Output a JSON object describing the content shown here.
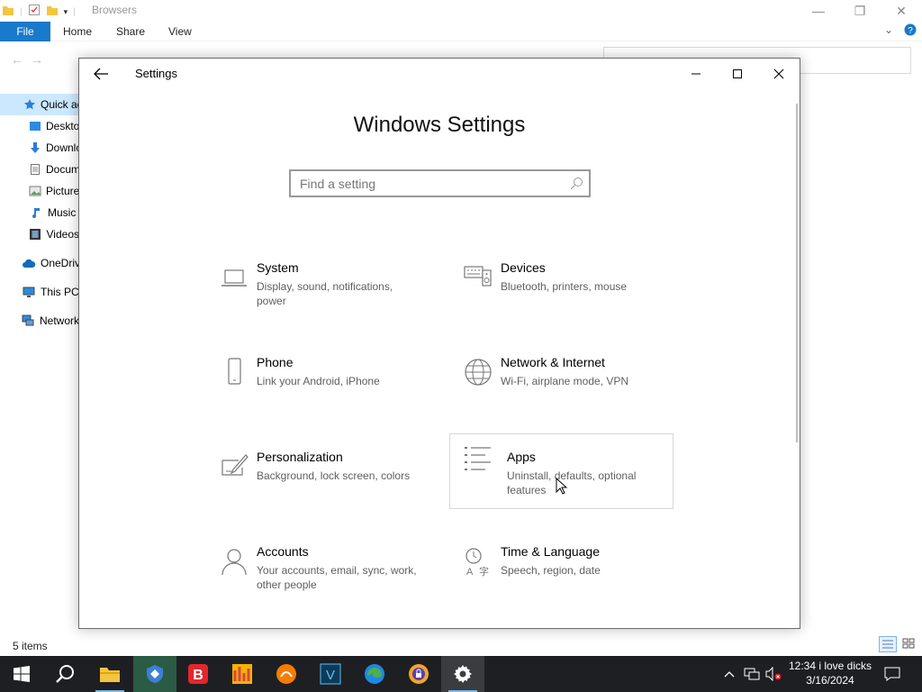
{
  "explorer": {
    "title": "Browsers",
    "ribbon_tabs": [
      "File",
      "Home",
      "Share",
      "View"
    ],
    "sidebar": [
      {
        "label": "Quick access",
        "icon": "star-icon"
      },
      {
        "label": "Desktop",
        "icon": "desktop-folder-icon"
      },
      {
        "label": "Downloads",
        "icon": "download-arrow-icon"
      },
      {
        "label": "Documents",
        "icon": "document-icon"
      },
      {
        "label": "Pictures",
        "icon": "picture-icon"
      },
      {
        "label": "Music",
        "icon": "music-note-icon"
      },
      {
        "label": "Videos",
        "icon": "film-icon"
      },
      {
        "label": "OneDrive",
        "icon": "cloud-icon"
      },
      {
        "label": "This PC",
        "icon": "monitor-icon"
      },
      {
        "label": "Network",
        "icon": "network-icon"
      }
    ],
    "status": "5 items"
  },
  "settings": {
    "window_title": "Settings",
    "heading": "Windows Settings",
    "search_placeholder": "Find a setting",
    "tiles": [
      {
        "name": "System",
        "desc": "Display, sound, notifications, power",
        "icon": "laptop-icon"
      },
      {
        "name": "Devices",
        "desc": "Bluetooth, printers, mouse",
        "icon": "keyboard-speaker-icon"
      },
      {
        "name": "Phone",
        "desc": "Link your Android, iPhone",
        "icon": "phone-icon"
      },
      {
        "name": "Network & Internet",
        "desc": "Wi-Fi, airplane mode, VPN",
        "icon": "globe-icon"
      },
      {
        "name": "Personalization",
        "desc": "Background, lock screen, colors",
        "icon": "paint-brush-icon"
      },
      {
        "name": "Apps",
        "desc": "Uninstall, defaults, optional features",
        "icon": "apps-list-icon"
      },
      {
        "name": "Accounts",
        "desc": "Your accounts, email, sync, work, other people",
        "icon": "person-icon"
      },
      {
        "name": "Time & Language",
        "desc": "Speech, region, date",
        "icon": "time-language-icon"
      }
    ],
    "hovered_tile": "Apps"
  },
  "taskbar": {
    "apps": [
      "start-icon",
      "search-icon",
      "file-explorer-icon",
      "app-shield-icon",
      "browser-b-icon",
      "chart-app-icon",
      "browser-orange-icon",
      "app-v-icon",
      "edge-icon",
      "browser-lock-icon",
      "settings-gear-icon"
    ],
    "clock_time": "12:34 i love dicks",
    "clock_date": "3/16/2024"
  },
  "colors": {
    "accent": "#1979ca",
    "taskbar": "#1e1f22",
    "selection": "#cce8ff"
  }
}
